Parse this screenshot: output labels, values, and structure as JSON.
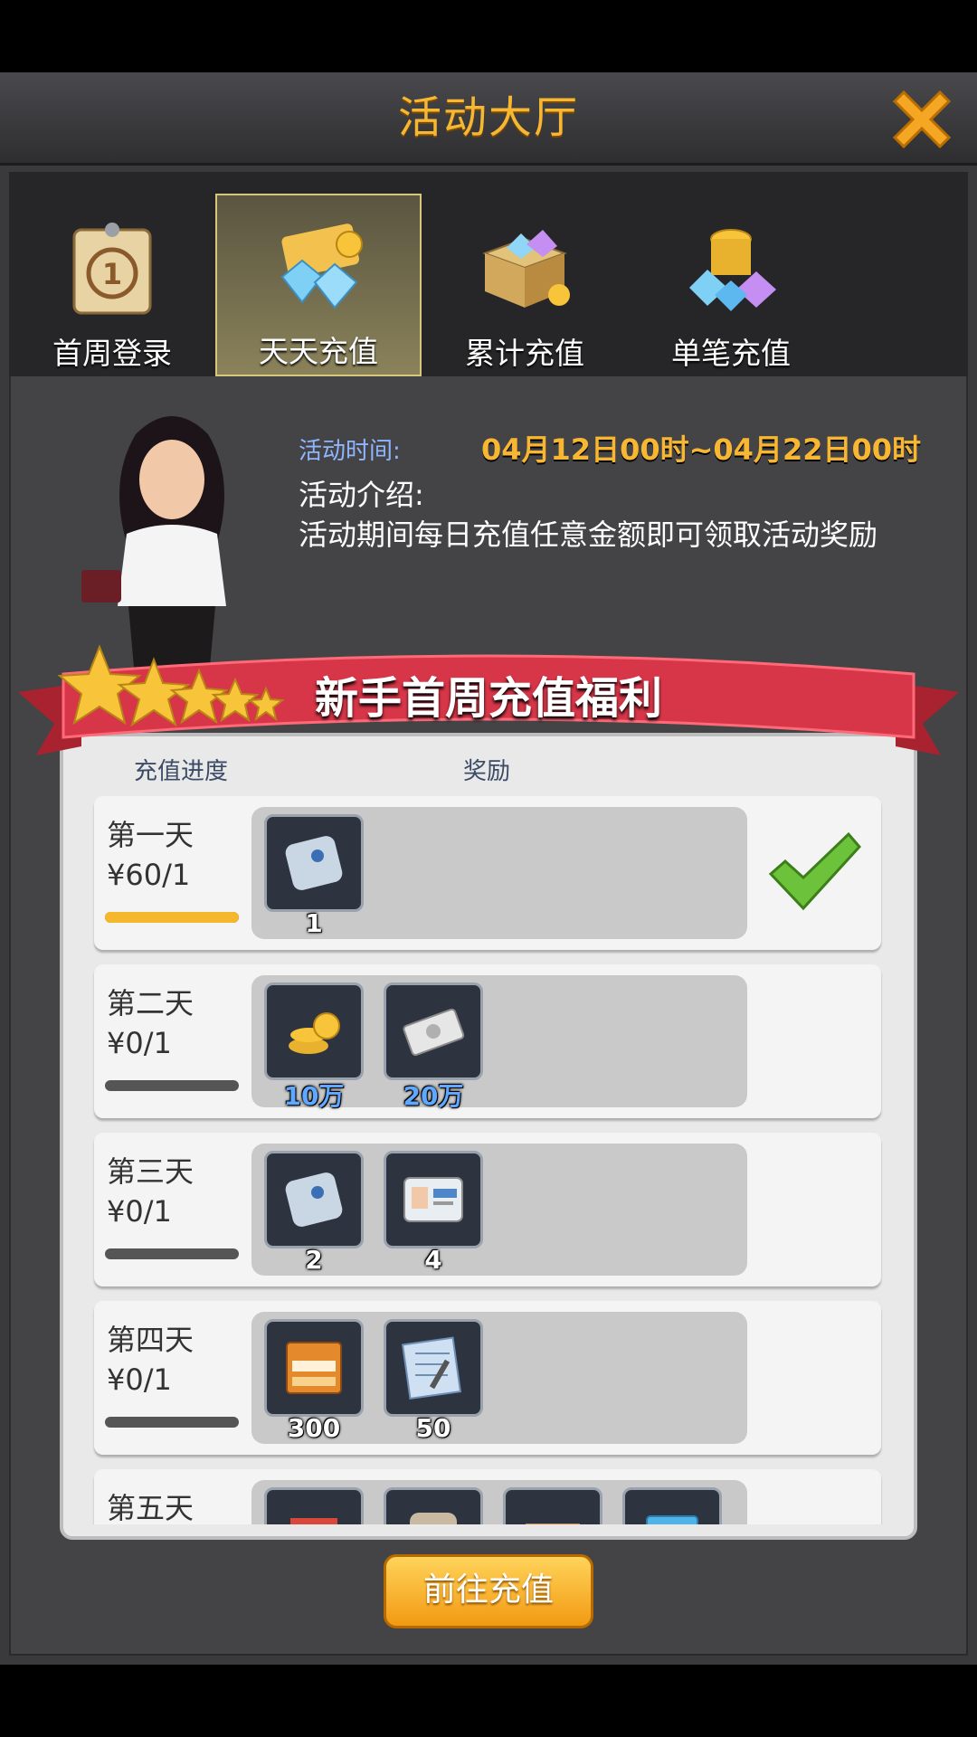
{
  "window": {
    "title": "活动大厅"
  },
  "tabs": [
    {
      "label": "首周登录",
      "icon": "calendar-icon"
    },
    {
      "label": "天天充值",
      "icon": "diamonds-coins-icon",
      "active": true
    },
    {
      "label": "累计充值",
      "icon": "treasure-box-icon"
    },
    {
      "label": "单笔充值",
      "icon": "gem-pile-icon"
    }
  ],
  "info": {
    "time_label": "活动时间:",
    "time_value": "04月12日00时~04月22日00时",
    "intro_label": "活动介绍:",
    "intro_text": "活动期间每日充值任意金额即可领取活动奖励"
  },
  "banner": {
    "title": "新手首周充值福利"
  },
  "columns": {
    "progress": "充值进度",
    "reward": "奖励"
  },
  "rows": [
    {
      "day": "第一天",
      "amount": "¥60/1",
      "progress": 1.0,
      "claimed": true,
      "rewards": [
        {
          "icon": "scroll-icon",
          "qty": "1"
        }
      ]
    },
    {
      "day": "第二天",
      "amount": "¥0/1",
      "progress": 0,
      "rewards": [
        {
          "icon": "gold-coins-icon",
          "qty": "10万"
        },
        {
          "icon": "cash-stack-icon",
          "qty": "20万"
        }
      ]
    },
    {
      "day": "第三天",
      "amount": "¥0/1",
      "progress": 0,
      "rewards": [
        {
          "icon": "scroll-icon",
          "qty": "2"
        },
        {
          "icon": "id-card-icon",
          "qty": "4"
        }
      ]
    },
    {
      "day": "第四天",
      "amount": "¥0/1",
      "progress": 0,
      "rewards": [
        {
          "icon": "movie-ticket-icon",
          "qty": "300"
        },
        {
          "icon": "blueprint-icon",
          "qty": "50"
        }
      ]
    },
    {
      "day": "第五天",
      "amount": "",
      "progress": 0,
      "rewards": [
        {
          "icon": "brick-icon",
          "qty": ""
        },
        {
          "icon": "cement-bag-icon",
          "qty": ""
        },
        {
          "icon": "wood-plank-icon",
          "qty": ""
        },
        {
          "icon": "glass-icon",
          "qty": ""
        }
      ]
    }
  ],
  "cta": {
    "label": "前往充值"
  },
  "colors": {
    "accent": "#f7b733",
    "frame": "#3a3a3c",
    "ribbon": "#d63648"
  }
}
